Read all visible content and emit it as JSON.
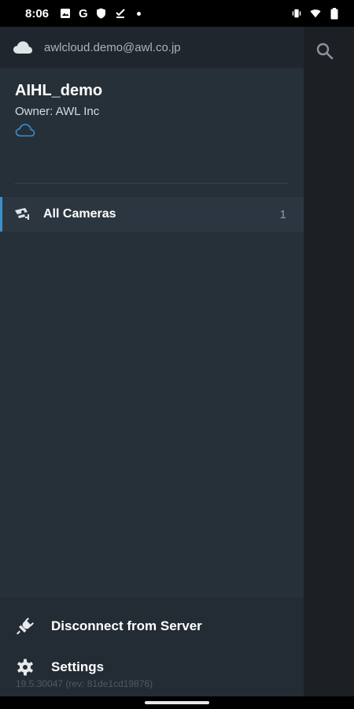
{
  "status_bar": {
    "time": "8:06",
    "google_letter": "G",
    "left_icons": [
      "photo-icon",
      "google-icon",
      "shield-icon",
      "download-done-icon",
      "notification-dot-icon"
    ],
    "right_icons": [
      "vibrate-icon",
      "wifi-icon",
      "battery-icon"
    ]
  },
  "account": {
    "email": "awlcloud.demo@awl.co.jp",
    "icon": "cloud-icon"
  },
  "server": {
    "name": "AIHL_demo",
    "owner": "Owner: AWL Inc",
    "icon": "cloud-outline-icon"
  },
  "camera_list": [
    {
      "label": "All Cameras",
      "count": "1",
      "icon": "camera-icon",
      "selected": true
    }
  ],
  "menu": {
    "disconnect_label": "Disconnect from Server",
    "settings_label": "Settings"
  },
  "version": "19.5.30047 (rev: 81de1cd19876)",
  "colors": {
    "accent": "#3a8fd0",
    "drawer_bg": "#263039",
    "account_bar_bg": "#1f262d",
    "bottom_bg": "#232c34"
  }
}
